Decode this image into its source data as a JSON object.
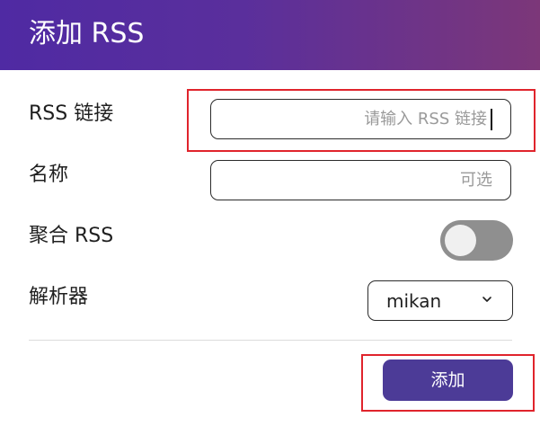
{
  "dialog": {
    "title": "添加 RSS"
  },
  "form": {
    "rss_link": {
      "label": "RSS 链接",
      "placeholder": "请输入 RSS 链接"
    },
    "name": {
      "label": "名称",
      "placeholder": "可选"
    },
    "aggregate": {
      "label": "聚合 RSS",
      "enabled": false
    },
    "parser": {
      "label": "解析器",
      "selected": "mikan"
    }
  },
  "actions": {
    "add_label": "添加"
  },
  "colors": {
    "header_gradient_start": "#4f2aa3",
    "header_gradient_end": "#7c3779",
    "button": "#4c3b97",
    "highlight": "#e0242c",
    "toggle_off": "#8f8f8f"
  }
}
